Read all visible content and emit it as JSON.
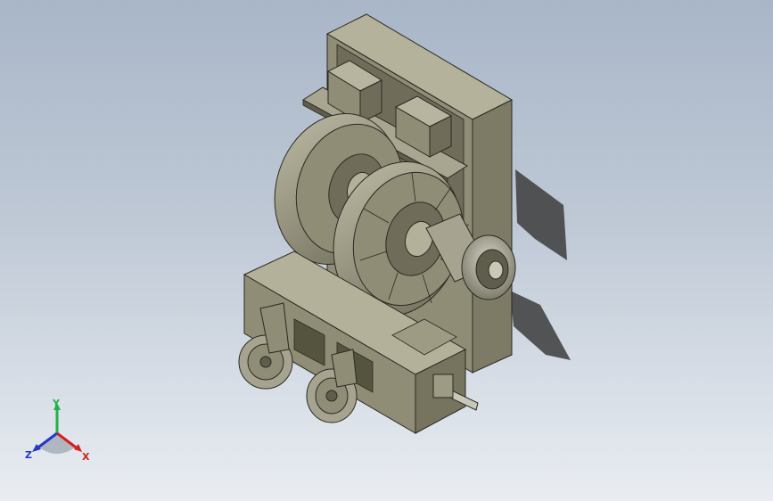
{
  "viewport": {
    "background_top": "#a9b6c8",
    "background_bottom": "#e9edf2"
  },
  "triad": {
    "x_label": "X",
    "y_label": "Y",
    "z_label": "Z",
    "x_color": "#d42020",
    "y_color": "#22b14c",
    "z_color": "#2438c8"
  },
  "model": {
    "body_color": "#8f8d76",
    "shade_color": "#6f6d5a",
    "light_color": "#b3b19a",
    "edge_color": "#2a2a22"
  }
}
